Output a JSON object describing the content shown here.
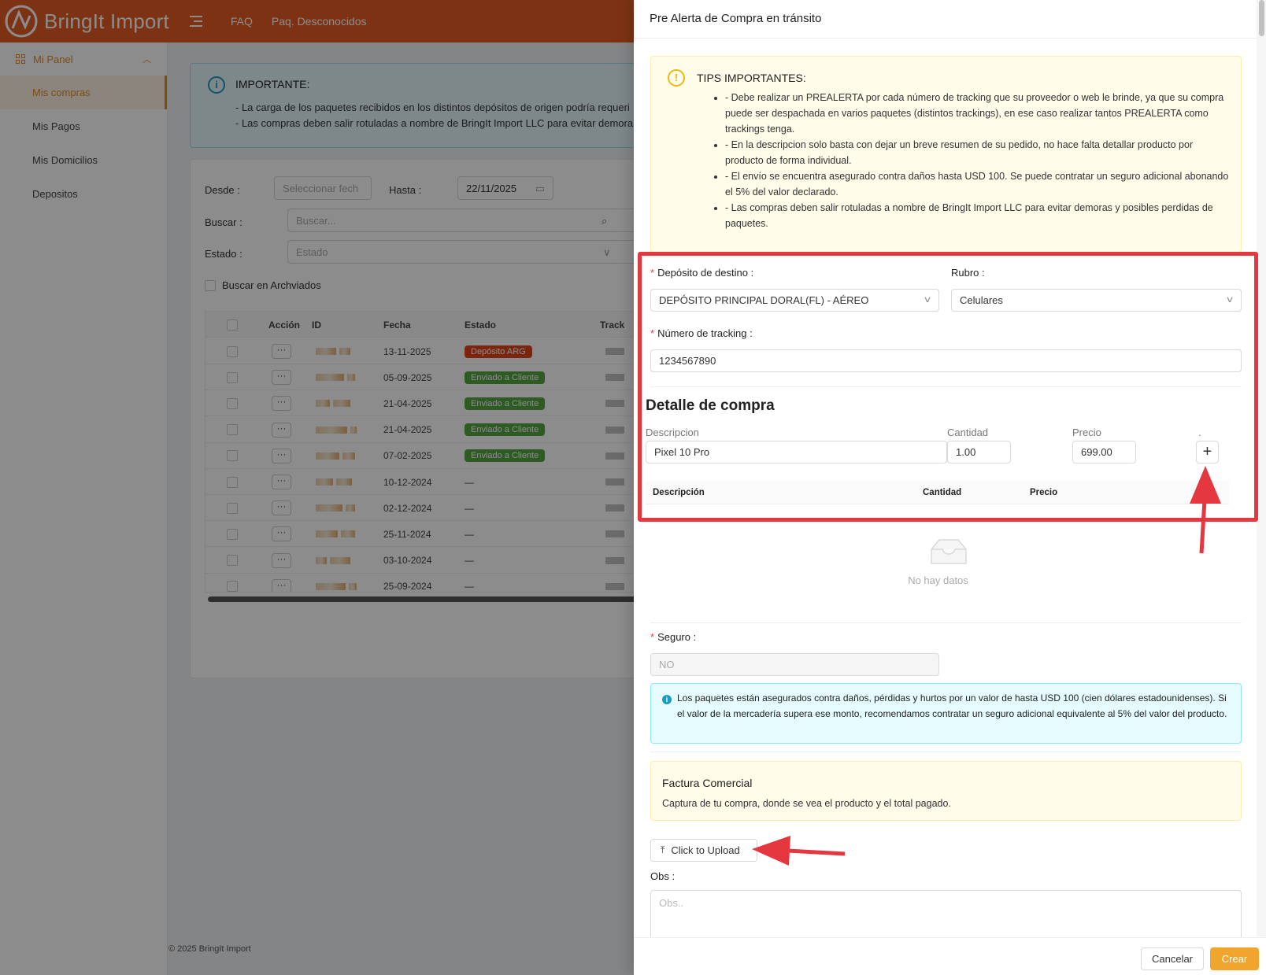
{
  "app": {
    "brand": "BringIt Import",
    "nav": [
      "FAQ",
      "Paq. Desconocidos"
    ],
    "colors": {
      "header": "#e35d24",
      "accent": "#e38b23",
      "create_button": "#f0a52c",
      "annotation": "#e4373f"
    }
  },
  "sidebar": {
    "group": "Mi Panel",
    "items": [
      {
        "label": "Mis compras",
        "active": true
      },
      {
        "label": "Mis Pagos"
      },
      {
        "label": "Mis Domicilios"
      },
      {
        "label": "Depositos"
      }
    ]
  },
  "notice": {
    "title": "IMPORTANTE:",
    "lines": [
      "- La carga de los paquetes recibidos en los distintos depósitos de origen podría requeri",
      "- Las compras deben salir rotuladas a nombre de BringIt Import LLC para evitar demora"
    ]
  },
  "filters": {
    "desde_label": "Desde",
    "desde_placeholder": "Seleccionar fech",
    "hasta_label": "Hasta",
    "hasta_value": "22/11/2025",
    "buscar_label": "Buscar",
    "buscar_placeholder": "Buscar...",
    "estado_label": "Estado",
    "estado_placeholder": "Estado",
    "archivados_label": "Buscar en Archviados"
  },
  "table": {
    "headers": [
      "Acción",
      "ID",
      "Fecha",
      "Estado",
      "Track"
    ],
    "action_label": "···",
    "rows": [
      {
        "fecha": "13-11-2025",
        "estado": "Depósito ARG",
        "tone": "red"
      },
      {
        "fecha": "05-09-2025",
        "estado": "Enviado a Cliente",
        "tone": "green"
      },
      {
        "fecha": "21-04-2025",
        "estado": "Enviado a Cliente",
        "tone": "green"
      },
      {
        "fecha": "21-04-2025",
        "estado": "Enviado a Cliente",
        "tone": "green"
      },
      {
        "fecha": "07-02-2025",
        "estado": "Enviado a Cliente",
        "tone": "green"
      },
      {
        "fecha": "10-12-2024",
        "estado": "—",
        "tone": "none"
      },
      {
        "fecha": "02-12-2024",
        "estado": "—",
        "tone": "none"
      },
      {
        "fecha": "25-11-2024",
        "estado": "—",
        "tone": "none"
      },
      {
        "fecha": "03-10-2024",
        "estado": "—",
        "tone": "none"
      },
      {
        "fecha": "25-09-2024",
        "estado": "—",
        "tone": "none"
      }
    ]
  },
  "footer": {
    "copyright": "© 2025 BringIt Import"
  },
  "drawer": {
    "title": "Pre Alerta de Compra en tránsito",
    "tips": {
      "title": "TIPS IMPORTANTES:",
      "items": [
        "- Debe realizar un PREALERTA por cada número de tracking que su proveedor o web le brinde, ya que su compra puede ser despachada en varios paquetes (distintos trackings), en ese caso realizar tantos PREALERTA como trackings tenga.",
        "- En la descripcion solo basta con dejar un breve resumen de su pedido, no hace falta detallar producto por producto de forma individual.",
        "- El envío se encuentra asegurado contra daños hasta USD 100. Se puede contratar un seguro adicional abonando el 5% del valor declarado.",
        "- Las compras deben salir rotuladas a nombre de BringIt Import LLC para evitar demoras y posibles perdidas de paquetes."
      ]
    },
    "deposito_label": "Depósito de destino",
    "deposito_value": "DEPÓSITO PRINCIPAL DORAL(FL) - AÉREO",
    "rubro_label": "Rubro",
    "rubro_value": "Celulares",
    "tracking_label": "Número de tracking",
    "tracking_value": "1234567890",
    "detalle_title": "Detalle de compra",
    "desc_label": "Descripcion",
    "desc_value": "Pixel 10 Pro",
    "cant_label": "Cantidad",
    "cant_value": "1.00",
    "precio_label": "Precio",
    "precio_value": "699.00",
    "dot_label": ".",
    "plus_label": "+",
    "mini_headers": [
      "Descripción",
      "Cantidad",
      "Precio"
    ],
    "empty_text": "No hay datos",
    "seguro_label": "Seguro",
    "seguro_value": "NO",
    "seguro_info": "Los paquetes están asegurados contra daños, pérdidas y hurtos por un valor de hasta USD 100 (cien dólares estadounidenses). Si el valor de la mercadería supera ese monto, recomendamos contratar un seguro adicional equivalente al 5% del valor del producto.",
    "factura_title": "Factura Comercial",
    "factura_sub": "Captura de tu compra, donde se vea el producto y el total pagado.",
    "upload_label": "Click to Upload",
    "obs_label": "Obs",
    "obs_placeholder": "Obs..",
    "cancel_label": "Cancelar",
    "create_label": "Crear"
  }
}
